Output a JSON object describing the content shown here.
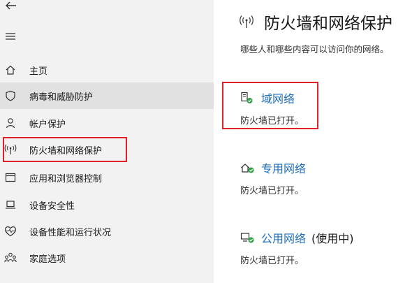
{
  "sidebar": {
    "items": [
      {
        "label": "主页",
        "icon": "home-icon"
      },
      {
        "label": "病毒和威胁防护",
        "icon": "shield-icon"
      },
      {
        "label": "帐户保护",
        "icon": "person-icon"
      },
      {
        "label": "防火墙和网络保护",
        "icon": "antenna-icon"
      },
      {
        "label": "应用和浏览器控制",
        "icon": "browser-window-icon"
      },
      {
        "label": "设备安全性",
        "icon": "laptop-icon"
      },
      {
        "label": "设备性能和运行状况",
        "icon": "heart-icon"
      },
      {
        "label": "家庭选项",
        "icon": "family-icon"
      }
    ]
  },
  "page": {
    "title": "防火墙和网络保护",
    "subtitle": "哪些人和哪些内容可以访问你的网络。"
  },
  "networks": [
    {
      "name": "域网络",
      "extra": "",
      "status": "防火墙已打开。",
      "icon": "domain-network-icon"
    },
    {
      "name": "专用网络",
      "extra": "",
      "status": "防火墙已打开。",
      "icon": "private-network-icon"
    },
    {
      "name": "公用网络",
      "extra": "(使用中)",
      "status": "防火墙已打开。",
      "icon": "public-network-icon"
    }
  ],
  "colors": {
    "sidebar_bg": "#f2f2f2",
    "active_bg": "#e1e1e1",
    "link_blue": "#1f6fbf",
    "check_green": "#2ea043",
    "highlight_red": "#e0202a"
  }
}
